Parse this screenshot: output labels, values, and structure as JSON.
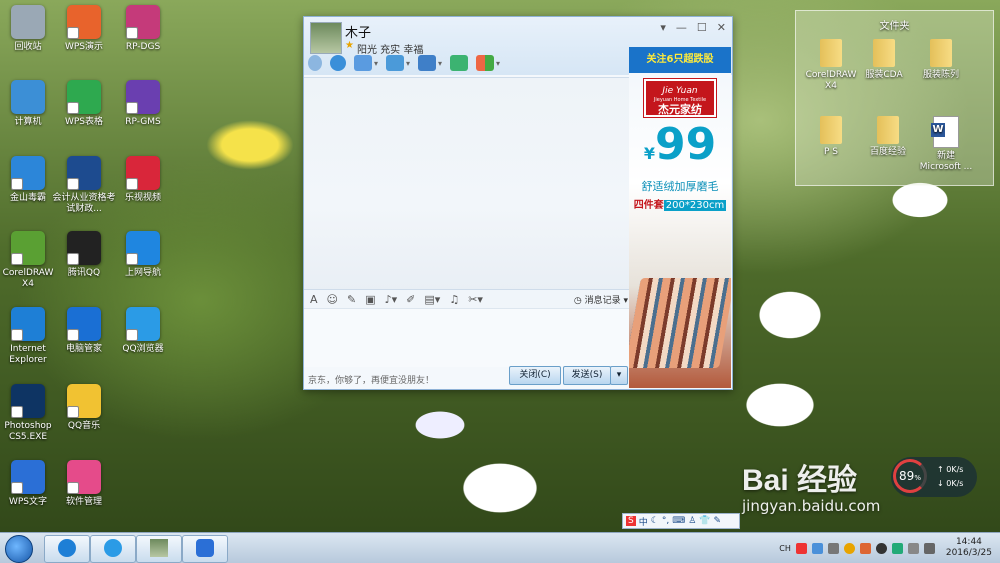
{
  "desktop": {
    "icons": [
      {
        "label": "回收站",
        "color": "#9aa8b5"
      },
      {
        "label": "WPS演示",
        "color": "#e8632c"
      },
      {
        "label": "RP-DGS",
        "color": "#c53a7a"
      },
      {
        "label": "计算机",
        "color": "#3c8fd6"
      },
      {
        "label": "WPS表格",
        "color": "#2ea94f"
      },
      {
        "label": "RP-GMS",
        "color": "#6a3fb0"
      },
      {
        "label": "金山毒霸",
        "color": "#2c86d9"
      },
      {
        "label": "会计从业资格考试财政...",
        "color": "#1d4b8f"
      },
      {
        "label": "乐视视频",
        "color": "#d9263a"
      },
      {
        "label": "CorelDRAW X4",
        "color": "#5aa033"
      },
      {
        "label": "腾讯QQ",
        "color": "#222222"
      },
      {
        "label": "上网导航",
        "color": "#1f86e0"
      },
      {
        "label": "Internet Explorer",
        "color": "#1e7fd6"
      },
      {
        "label": "电脑管家",
        "color": "#1a6fd4"
      },
      {
        "label": "QQ浏览器",
        "color": "#2b9be6"
      },
      {
        "label": "Photoshop CS5.EXE",
        "color": "#0e3463"
      },
      {
        "label": "QQ音乐",
        "color": "#f1c232"
      },
      {
        "label": "WPS文字",
        "color": "#2b6fd6"
      },
      {
        "label": "软件管理",
        "color": "#e54b8a"
      }
    ]
  },
  "chat": {
    "contact_name": "木子",
    "signature": "阳光  充实  幸福",
    "message_log_label": "消息记录",
    "ad_text": "京东，你够了，再便宜没朋友！",
    "close_button": "关闭(C)",
    "send_button": "发送(S)",
    "ad": {
      "banner": "关注6只超跌股",
      "brand_cn": "杰元家纺",
      "brand_en": "Jieyuan Home Textile",
      "brand_script": "Jie Yuan",
      "price": "99",
      "currency": "¥",
      "line1": "舒适绒加厚磨毛",
      "line2_prefix": "四件套",
      "line2_size": "200*230cm"
    }
  },
  "folders": {
    "title": "文件夹",
    "items": [
      {
        "label": "CorelDRAW X4",
        "type": "folder"
      },
      {
        "label": "服装CDA",
        "type": "folder"
      },
      {
        "label": "服装陈列",
        "type": "folder"
      },
      {
        "label": "P S",
        "type": "folder"
      },
      {
        "label": "百度经验",
        "type": "folder"
      },
      {
        "label": "新建 Microsoft ...",
        "type": "doc"
      }
    ]
  },
  "ime": {
    "lang": "中"
  },
  "net": {
    "percent": "89",
    "unit": "%",
    "up": "0K/s",
    "down": "0K/s"
  },
  "taskbar": {
    "time": "14:44",
    "date": "2016/3/25",
    "tray_lang": "CH"
  },
  "watermark": {
    "brand": "Bai 经验",
    "url": "jingyan.baidu.com"
  }
}
